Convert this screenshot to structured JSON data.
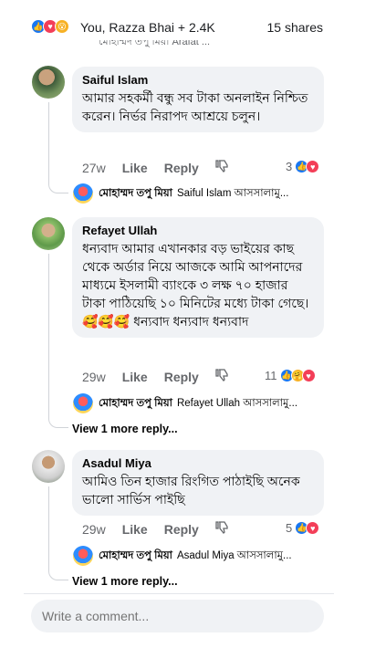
{
  "header": {
    "reactions_text": "You, Razza Bhai + 2.4K",
    "shares": "15 shares",
    "cut_off_reply": "মোহাম্মদ তপু মিয়া Arafat ..."
  },
  "comments": [
    {
      "name": "Saiful Islam",
      "text": "আমার সহকর্মী বন্ধু সব টাকা অনলাইন নিশ্চিত করেন। নির্ভর নিরাপদ আশ্রয়ে চলুন।",
      "time": "27w",
      "like": "Like",
      "reply": "Reply",
      "reaction_count": "3",
      "reactions": [
        "like",
        "love"
      ],
      "reply_author": "মোহাম্মদ তপু মিয়া",
      "reply_text": "Saiful Islam আসসালামু..."
    },
    {
      "name": "Refayet Ullah",
      "text": "ধন্যবাদ আমার এখানকার বড় ভাইয়ের কাছ থেকে অর্ডার নিয়ে আজকে আমি আপনাদের মাধ্যমে ইসলামী ব্যাংকে ৩ লক্ষ ৭০ হাজার টাকা পাঠিয়েছি ১০ মিনিটের মধ্যে টাকা গেছে।🥰🥰🥰 ধন্যবাদ ধন্যবাদ ধন্যবাদ",
      "time": "29w",
      "like": "Like",
      "reply": "Reply",
      "reaction_count": "11",
      "reactions": [
        "like",
        "care",
        "love"
      ],
      "reply_author": "মোহাম্মদ তপু মিয়া",
      "reply_text": "Refayet Ullah আসসালামু...",
      "more": "View 1 more reply..."
    },
    {
      "name": "Asadul Miya",
      "text": "আমিও তিন হাজার রিংগিত পাঠাইছি অনেক ভালো সার্ভিস পাইছি",
      "time": "29w",
      "like": "Like",
      "reply": "Reply",
      "reaction_count": "5",
      "reactions": [
        "like",
        "love"
      ],
      "reply_author": "মোহাম্মদ তপু মিয়া",
      "reply_text": "Asadul Miya আসসালামু...",
      "more": "View 1 more reply..."
    }
  ],
  "composer": {
    "placeholder": "Write a comment..."
  },
  "icons": {
    "thumbs_down": "thumbs-down-icon",
    "like": "like-reaction-icon",
    "love": "love-reaction-icon",
    "wow": "wow-reaction-icon",
    "care": "care-reaction-icon"
  },
  "colors": {
    "like": "#1877f2",
    "love": "#f33e58",
    "bubble": "#f0f2f5"
  }
}
